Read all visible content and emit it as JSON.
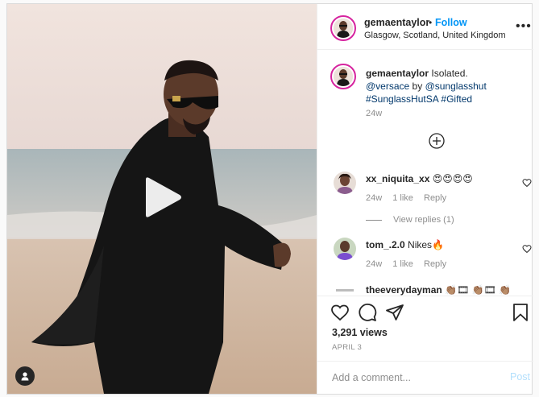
{
  "header": {
    "username": "gemaentaylor",
    "dot": "•",
    "follow_label": "Follow",
    "location": "Glasgow, Scotland, United Kingdom",
    "more_icon": "more-horizontal-icon"
  },
  "caption": {
    "username": "gemaentaylor",
    "text": "Isolated.",
    "mention_1": "@versace",
    "by": "by",
    "mention_2": "@sunglasshut",
    "hashtags": "#SunglassHutSA #Gifted",
    "time": "24w"
  },
  "comments": [
    {
      "username": "xx_niquita_xx",
      "text": "😍😍😍😍",
      "time": "24w",
      "likes": "1 like",
      "reply_label": "Reply"
    },
    {
      "username": "tom_.2.0",
      "text": "Nikes🔥",
      "time": "24w",
      "likes": "1 like",
      "reply_label": "Reply"
    },
    {
      "username": "theeverydayman",
      "text": "👏🏽🎞 👏🏽🎞 👏🏽"
    }
  ],
  "view_replies": "View replies (1)",
  "stats": {
    "views": "3,291 views",
    "date": "APRIL 3"
  },
  "add_comment": {
    "placeholder": "Add a comment...",
    "post_label": "Post"
  },
  "colors": {
    "link": "#0095f6",
    "mention": "#00376b",
    "muted": "#8e8e8e",
    "story_ring": "#d6249f"
  }
}
